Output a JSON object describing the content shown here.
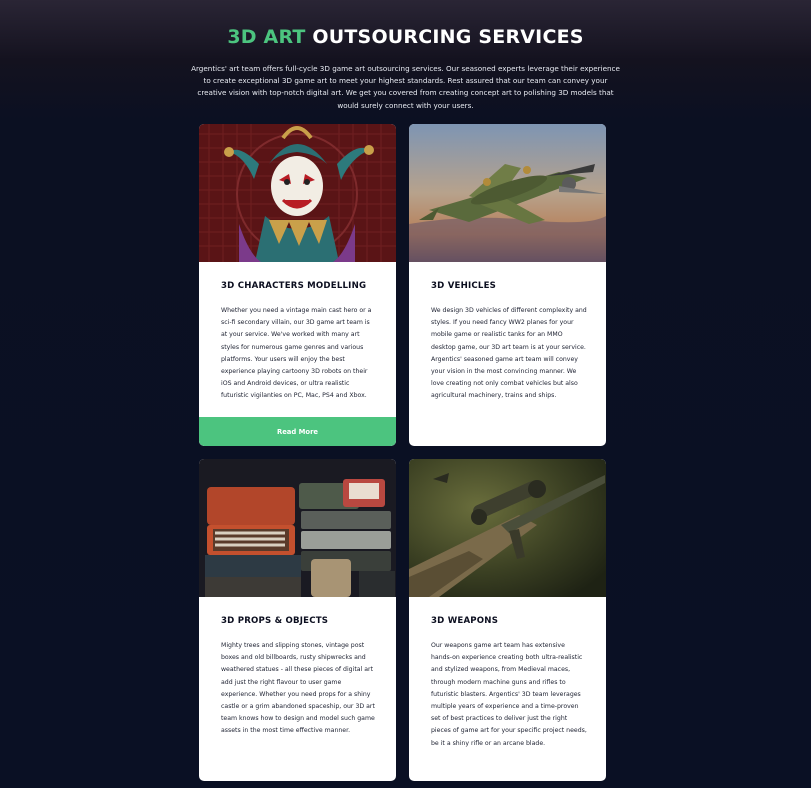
{
  "header": {
    "title_accent": "3D ART",
    "title_rest": "OUTSOURCING SERVICES",
    "intro": "Argentics' art team offers full-cycle 3D game art outsourcing services. Our seasoned experts leverage their experience to create exceptional 3D game art to meet your highest standards. Rest assured that our team can convey your creative vision with top-notch digital art. We get you covered from creating concept art to polishing 3D models that would surely connect with your users."
  },
  "cards": [
    {
      "title": "3D CHARACTERS MODELLING",
      "text": "Whether you need a vintage main cast hero or a sci-fi secondary villain, our 3D game art team is at your service. We've worked with many art styles for numerous game genres and various platforms. Your users will enjoy the best experience playing cartoony 3D robots on their iOS and Android devices, or ultra realistic futuristic vigilanties on PC, Mac, PS4 and Xbox.",
      "button": "Read More"
    },
    {
      "title": "3D VEHICLES",
      "text": "We design 3D vehicles of different complexity and styles. If you need fancy WW2 planes for your mobile game or realistic tanks for an MMO desktop game, our 3D art team is at your service. Argentics' seasoned game art team will convey your vision in the most convincing manner. We love creating not only combat vehicles but also agricultural machinery, trains and ships."
    },
    {
      "title": "3D PROPS & OBJECTS",
      "text": "Mighty trees and slipping stones, vintage post boxes and old billboards, rusty shipwrecks and weathered statues - all these pieces of digital art add just the right flavour to user game experience. Whether you need props for a shiny castle or a grim abandoned spaceship, our 3D art team knows how to design and model such game assets in the most time effective manner."
    },
    {
      "title": "3D WEAPONS",
      "text": "Our weapons game art team has extensive hands-on experience creating both ultra-realistic and stylized weapons, from Medieval maces, through modern machine guns and rifles to futuristic blasters. Argentics' 3D team leverages multiple years of experience and a time-proven set of best practices to deliver just the right pieces of game art for your specific project needs, be it a shiny rifle or an arcane blade."
    }
  ]
}
